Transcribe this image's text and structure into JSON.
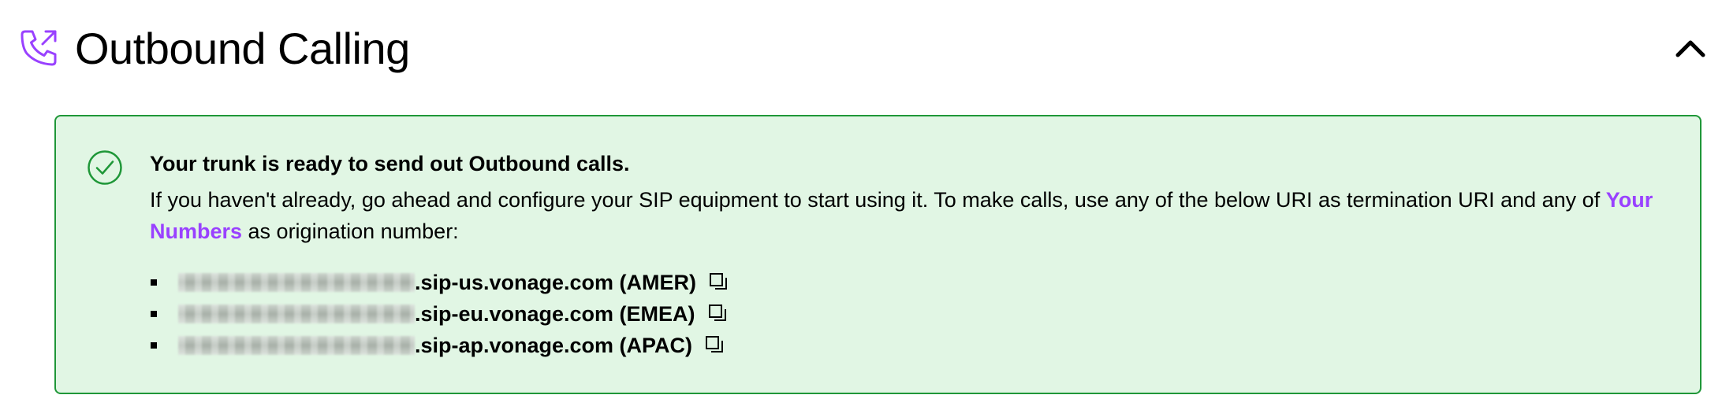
{
  "section": {
    "title": "Outbound Calling",
    "icon": "phone-outgoing-icon",
    "accent_color": "#9941ff",
    "collapse_icon": "chevron-up-icon"
  },
  "notice": {
    "status": "success",
    "background_color": "#e1f6e4",
    "border_color": "#1f9738",
    "icon": "check-circle-icon",
    "heading": "Your trunk is ready to send out Outbound calls.",
    "text_before_link": "If you haven't already, go ahead and configure your SIP equipment to start using it. To make calls, use any of the below URI as termination URI and any of ",
    "link_label": "Your Numbers",
    "text_after_link": " as origination number:",
    "uris": [
      {
        "redacted_prefix": true,
        "suffix": ".sip-us.vonage.com (AMER)",
        "copy_icon": "copy-icon"
      },
      {
        "redacted_prefix": true,
        "suffix": ".sip-eu.vonage.com (EMEA)",
        "copy_icon": "copy-icon"
      },
      {
        "redacted_prefix": true,
        "suffix": ".sip-ap.vonage.com (APAC)",
        "copy_icon": "copy-icon"
      }
    ]
  }
}
